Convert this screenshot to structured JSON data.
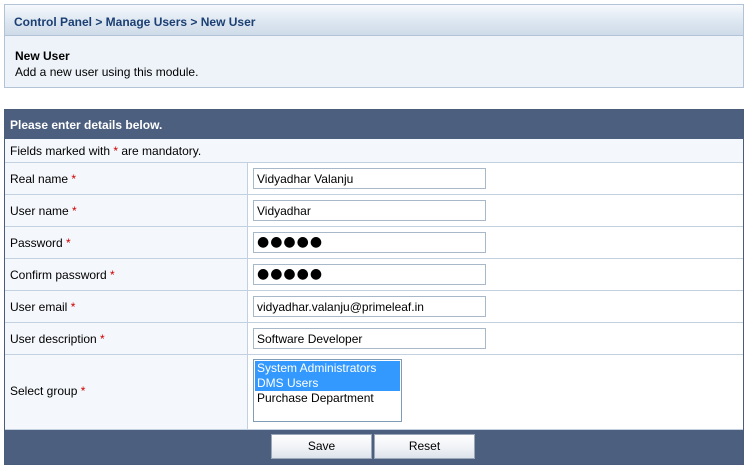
{
  "breadcrumb": "Control Panel > Manage Users > New User",
  "intro": {
    "title": "New User",
    "description": "Add a new user using this module."
  },
  "form": {
    "header": "Please enter details below.",
    "note_prefix": "Fields marked with ",
    "note_star": "*",
    "note_suffix": " are mandatory.",
    "fields": [
      {
        "label": "Real name",
        "value": "Vidyadhar Valanju"
      },
      {
        "label": "User name",
        "value": "Vidyadhar"
      },
      {
        "label": "Password",
        "value": "●●●●●"
      },
      {
        "label": "Confirm password",
        "value": "●●●●●"
      },
      {
        "label": "User email",
        "value": "vidyadhar.valanju@primeleaf.in"
      },
      {
        "label": "User description",
        "value": "Software Developer"
      }
    ],
    "group": {
      "label": "Select group",
      "options": [
        {
          "label": "System Administrators",
          "selected": true
        },
        {
          "label": "DMS Users",
          "selected": true
        },
        {
          "label": "Purchase Department",
          "selected": false
        }
      ]
    },
    "required_mark": "*",
    "save_label": "Save",
    "reset_label": "Reset"
  },
  "colors": {
    "header_bg": "#4d5f7e",
    "label_bg": "#f4f7fb",
    "required": "#cc0000",
    "selection": "#3399ff"
  }
}
